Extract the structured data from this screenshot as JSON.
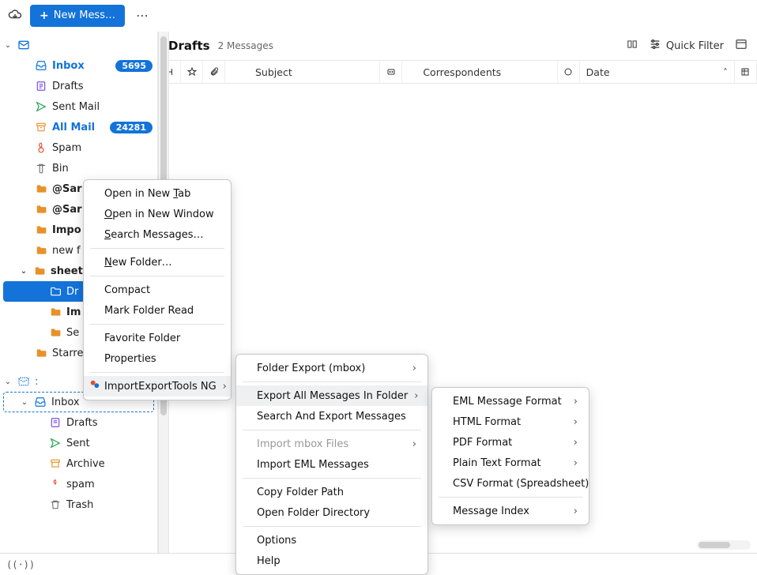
{
  "toolbar": {
    "new_message_label": "New Mess…",
    "quick_filter_label": "Quick Filter"
  },
  "sidebar": {
    "account1": {
      "inbox": "Inbox",
      "inbox_count": "5695",
      "drafts": "Drafts",
      "sent": "Sent Mail",
      "allmail": "All Mail",
      "allmail_count": "24281",
      "spam": "Spam",
      "bin": "Bin",
      "sar1": "@Sar",
      "sar2": "@Sar",
      "impo": "Impo",
      "newf": "new f",
      "sheet": "sheet",
      "dr": "Dr",
      "im": "Im",
      "se": "Se",
      "starred": "Starre"
    },
    "account2": {
      "inbox": "Inbox",
      "drafts": "Drafts",
      "sent": "Sent",
      "archive": "Archive",
      "spam": "spam",
      "trash": "Trash"
    }
  },
  "main": {
    "title": "Drafts",
    "subtitle": "2 Messages",
    "columns": {
      "subject": "Subject",
      "correspondents": "Correspondents",
      "date": "Date"
    }
  },
  "context_menu": {
    "open_tab": "Open in New Tab",
    "open_window": "Open in New Window",
    "search_messages": "Search Messages…",
    "new_folder": "New Folder…",
    "compact": "Compact",
    "mark_read": "Mark Folder Read",
    "favorite": "Favorite Folder",
    "properties": "Properties",
    "import_export": "ImportExportTools NG"
  },
  "submenu1": {
    "folder_export": "Folder Export (mbox)",
    "export_all": "Export All Messages In Folder",
    "search_export": "Search And Export Messages",
    "import_mbox": "Import mbox Files",
    "import_eml": "Import EML Messages",
    "copy_path": "Copy Folder Path",
    "open_dir": "Open Folder Directory",
    "options": "Options",
    "help": "Help"
  },
  "submenu2": {
    "eml": "EML Message Format",
    "html": "HTML Format",
    "pdf": "PDF Format",
    "plain": "Plain Text Format",
    "csv": "CSV Format (Spreadsheet)",
    "index": "Message Index"
  },
  "statusbar": {
    "connect_icon": "((·))"
  }
}
